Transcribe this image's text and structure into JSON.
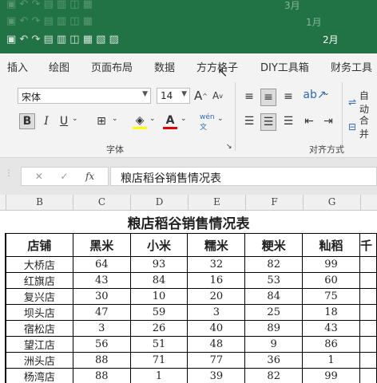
{
  "title_bars": {
    "months": [
      "3月",
      "1月",
      "2月"
    ]
  },
  "ribbon_tabs": [
    "插入",
    "绘图",
    "页面布局",
    "数据",
    "方方格子",
    "DIY工具箱",
    "财务工具"
  ],
  "font": {
    "name": "宋体",
    "size": "14",
    "group_label": "字体"
  },
  "alignment": {
    "group_label": "对齐方式",
    "wrap_label": "自动",
    "merge_label": "合并"
  },
  "formula_bar": {
    "content": "粮店稻谷销售情况表"
  },
  "columns": [
    "B",
    "C",
    "D",
    "E",
    "F",
    "G"
  ],
  "sheet": {
    "title": "粮店稻谷销售情况表",
    "headers": [
      "店铺",
      "黑米",
      "小米",
      "糯米",
      "粳米",
      "籼稻",
      "千"
    ],
    "rows": [
      [
        "大桥店",
        "64",
        "93",
        "32",
        "82",
        "99"
      ],
      [
        "红旗店",
        "43",
        "84",
        "16",
        "53",
        "60"
      ],
      [
        "复兴店",
        "30",
        "10",
        "20",
        "84",
        "75"
      ],
      [
        "坝头店",
        "47",
        "59",
        "3",
        "25",
        "18"
      ],
      [
        "宿松店",
        "3",
        "26",
        "40",
        "89",
        "43"
      ],
      [
        "望江店",
        "56",
        "51",
        "48",
        "9",
        "86"
      ],
      [
        "洲头店",
        "88",
        "71",
        "77",
        "36",
        "1"
      ],
      [
        "杨湾店",
        "88",
        "1",
        "39",
        "82",
        "99"
      ]
    ]
  }
}
